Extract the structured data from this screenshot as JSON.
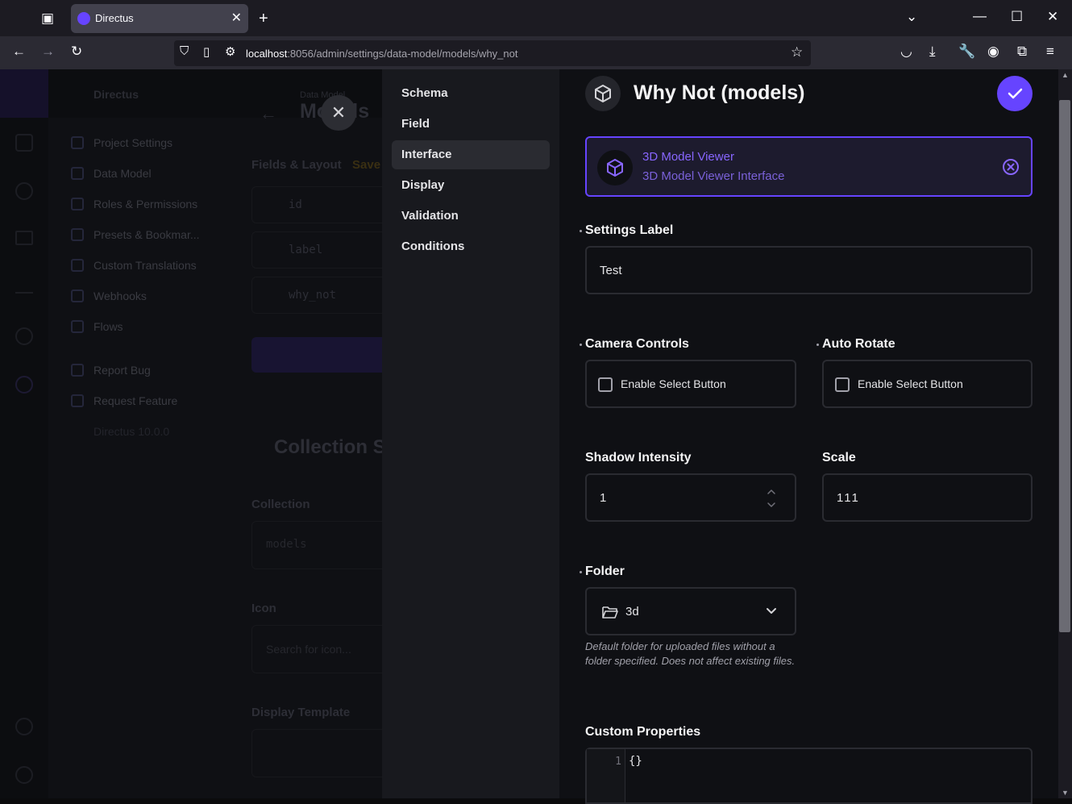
{
  "browser": {
    "tab_title": "Directus",
    "url_host": "localhost",
    "url_rest": ":8056/admin/settings/data-model/models/why_not"
  },
  "background_app": {
    "brand": "Directus",
    "breadcrumb": "Data Model",
    "page_title": "Models",
    "nav_items": [
      "Project Settings",
      "Data Model",
      "Roles & Permissions",
      "Presets & Bookmar...",
      "Custom Translations",
      "Webhooks",
      "Flows",
      "Report Bug",
      "Request Feature",
      "Directus 10.0.0"
    ],
    "fields_layout_label": "Fields & Layout",
    "save_hint": "Save",
    "fields": [
      "id",
      "label",
      "why_not"
    ],
    "collection_setup": "Collection S",
    "collection_label": "Collection",
    "collection_value": "models",
    "icon_label": "Icon",
    "icon_placeholder": "Search for icon...",
    "display_template_label": "Display Template"
  },
  "drawer_nav": [
    "Schema",
    "Field",
    "Interface",
    "Display",
    "Validation",
    "Conditions"
  ],
  "header": {
    "title": "Why Not (models)"
  },
  "interface_card": {
    "name": "3D Model Viewer",
    "description": "3D Model Viewer Interface"
  },
  "settings_label": {
    "label": "Settings Label",
    "value": "Test"
  },
  "camera_controls": {
    "label": "Camera Controls",
    "checkbox_label": "Enable Select Button"
  },
  "auto_rotate": {
    "label": "Auto Rotate",
    "checkbox_label": "Enable Select Button"
  },
  "shadow_intensity": {
    "label": "Shadow Intensity",
    "value": "1"
  },
  "scale": {
    "label": "Scale",
    "value": "111"
  },
  "folder": {
    "label": "Folder",
    "value": "3d",
    "hint": "Default folder for uploaded files without a folder specified. Does not affect existing files."
  },
  "custom_properties": {
    "label": "Custom Properties",
    "line_number": "1",
    "code": "{}"
  },
  "colors": {
    "accent": "#6644ff",
    "background": "#0f1014",
    "drawer_nav_bg": "#18191e"
  }
}
